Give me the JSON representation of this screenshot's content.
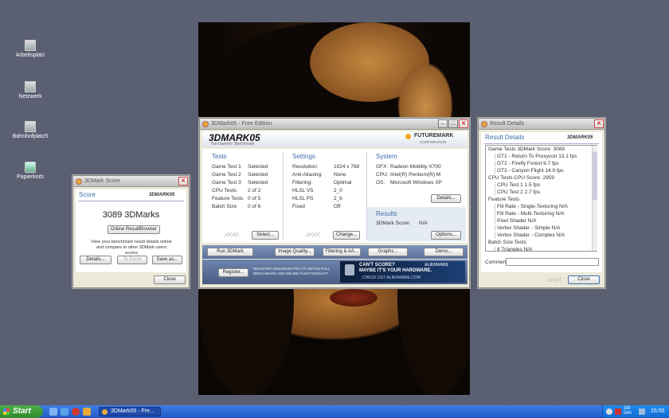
{
  "desktop": {
    "icons": [
      {
        "label": "Arbeitsplatz"
      },
      {
        "label": "Netzwerk"
      },
      {
        "label": "Bahnhofplatz5"
      },
      {
        "label": "Papierkorb"
      }
    ]
  },
  "main_window": {
    "title": "3DMark05 - Free Edition",
    "logo": "3DMARK05",
    "tagline": "The Gamers' Benchmark",
    "brand": "FUTUREMARK",
    "brand_sub": "CORPORATION",
    "tests": {
      "heading": "Tests",
      "rows": [
        {
          "label": "Game Test 1",
          "value": "Selected"
        },
        {
          "label": "Game Test 2",
          "value": "Selected"
        },
        {
          "label": "Game Test 3",
          "value": "Selected"
        },
        {
          "label": "CPU Tests:",
          "value": "2 of 2"
        },
        {
          "label": "Feature Tests",
          "value": "0 of 5"
        },
        {
          "label": "Batch Size",
          "value": "0 of 6"
        }
      ],
      "button": "Select..."
    },
    "settings": {
      "heading": "Settings",
      "rows": [
        {
          "label": "Resolution:",
          "value": "1024 x 768"
        },
        {
          "label": "Anti-Aliasing:",
          "value": "None"
        },
        {
          "label": "Filtering:",
          "value": "Optimal"
        },
        {
          "label": "HLSL VS",
          "value": "2_0"
        },
        {
          "label": "HLSL PS",
          "value": "2_b"
        },
        {
          "label": "Fixed",
          "value": "Off"
        }
      ],
      "button": "Change..."
    },
    "system": {
      "heading": "System",
      "rows": [
        {
          "label": "GFX:",
          "value": "Radeon Mobility X700"
        },
        {
          "label": "CPU:",
          "value": "Intel(R) Pentium(R) M"
        },
        {
          "label": "OS:",
          "value": "Microsoft Windows XP"
        }
      ],
      "button": "Details..."
    },
    "results": {
      "heading": "Results",
      "score_label": "3DMark Score:",
      "score_value": "N/A",
      "button": "Options..."
    },
    "toolbar": [
      "Run 3DMark",
      "Image Quality...",
      "Filtering & AA...",
      "Graphs...",
      "Demo..."
    ],
    "register_button": "Register...",
    "register_text": "REGISTER 3DMARK05 PRO TO OBTAIN FULL BENCHMARK AND ONLINE FUNCTIONALITY.",
    "ad_line1": "CAN'T SCORE?",
    "ad_line2": "MAYBE IT'S YOUR HARDWARE.",
    "ad_line3": "CHECK OUT ALIENWARE.COM",
    "ad_brand": "ALIENWARE"
  },
  "score_window": {
    "title": "3DMark Score",
    "heading": "Score",
    "logo": "3DMARK05",
    "score": "3089 3DMarks",
    "online_button": "Online ResultBrowser",
    "desc": "View your benchmark result details online and compare to other 3DMark users scores",
    "details_button": "Details...",
    "toexcel_button": "To Excel",
    "saveas_button": "Save as...",
    "close_button": "Close"
  },
  "result_window": {
    "title": "Result Details",
    "heading": "Result Details",
    "logo": "3DMARK05",
    "lines": [
      {
        "indent": 0,
        "text": "Game Tests   3DMark Score: 3089"
      },
      {
        "indent": 1,
        "text": "GT1 - Return To Proxycon   13.1 fps"
      },
      {
        "indent": 1,
        "text": "GT2 - Firefly Forest   9.7 fps"
      },
      {
        "indent": 1,
        "text": "GT3 - Canyon Flight   14.9 fps"
      },
      {
        "indent": 0,
        "text": "CPU Tests   CPU Score: 2959"
      },
      {
        "indent": 1,
        "text": "CPU Test 1   1.5 fps"
      },
      {
        "indent": 1,
        "text": "CPU Test 2   2.7 fps"
      },
      {
        "indent": 0,
        "text": "Feature Tests"
      },
      {
        "indent": 1,
        "text": "Fill Rate - Single-Texturing   N/A"
      },
      {
        "indent": 1,
        "text": "Fill Rate - Multi-Texturing   N/A"
      },
      {
        "indent": 1,
        "text": "Pixel Shader   N/A"
      },
      {
        "indent": 1,
        "text": "Vertex Shader - Simple   N/A"
      },
      {
        "indent": 1,
        "text": "Vertex Shader - Complex   N/A"
      },
      {
        "indent": 0,
        "text": "Batch Size Tests"
      },
      {
        "indent": 1,
        "text": "8 Triangles   N/A"
      }
    ],
    "comment_label": "Commen",
    "close_button": "Close"
  },
  "taskbar": {
    "start": "Start",
    "task_label": "3DMark05 - Fre...",
    "tray_text": "160 GHz",
    "clock": "15:55"
  }
}
